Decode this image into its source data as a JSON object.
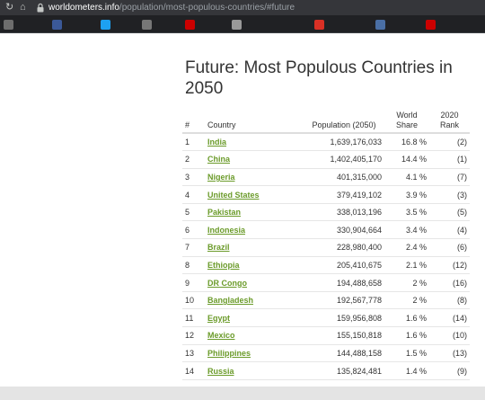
{
  "browser": {
    "url_domain": "worldometers.info",
    "url_path": "/population/most-populous-countries/#future",
    "refresh_icon": "refresh-icon",
    "home_icon": "home-icon",
    "lock_icon": "lock-icon"
  },
  "bookmarks": [
    {
      "color": "#6d6d6d"
    },
    {
      "color": "#3b5998"
    },
    {
      "color": "#1da1f2"
    },
    {
      "color": "#777777"
    },
    {
      "color": "#cc0000"
    },
    {
      "color": "#999999"
    },
    {
      "color": "#d93025"
    },
    {
      "color": "#4a6fa5"
    },
    {
      "color": "#cc0000"
    },
    {
      "color": "#d93025"
    }
  ],
  "page": {
    "title": "Future: Most Populous Countries in 2050",
    "link_color": "#6b9b2a"
  },
  "table": {
    "headers": {
      "rank": "#",
      "country": "Country",
      "population": "Population (2050)",
      "share": "World Share",
      "rank2020": "2020 Rank"
    },
    "rows": [
      {
        "n": "1",
        "country": "India",
        "population": "1,639,176,033",
        "share": "16.8 %",
        "rank2020": "(2)"
      },
      {
        "n": "2",
        "country": "China",
        "population": "1,402,405,170",
        "share": "14.4 %",
        "rank2020": "(1)"
      },
      {
        "n": "3",
        "country": "Nigeria",
        "population": "401,315,000",
        "share": "4.1 %",
        "rank2020": "(7)"
      },
      {
        "n": "4",
        "country": "United States",
        "population": "379,419,102",
        "share": "3.9 %",
        "rank2020": "(3)"
      },
      {
        "n": "5",
        "country": "Pakistan",
        "population": "338,013,196",
        "share": "3.5 %",
        "rank2020": "(5)"
      },
      {
        "n": "6",
        "country": "Indonesia",
        "population": "330,904,664",
        "share": "3.4 %",
        "rank2020": "(4)"
      },
      {
        "n": "7",
        "country": "Brazil",
        "population": "228,980,400",
        "share": "2.4 %",
        "rank2020": "(6)"
      },
      {
        "n": "8",
        "country": "Ethiopia",
        "population": "205,410,675",
        "share": "2.1 %",
        "rank2020": "(12)"
      },
      {
        "n": "9",
        "country": "DR Congo",
        "population": "194,488,658",
        "share": "2 %",
        "rank2020": "(16)"
      },
      {
        "n": "10",
        "country": "Bangladesh",
        "population": "192,567,778",
        "share": "2 %",
        "rank2020": "(8)"
      },
      {
        "n": "11",
        "country": "Egypt",
        "population": "159,956,808",
        "share": "1.6 %",
        "rank2020": "(14)"
      },
      {
        "n": "12",
        "country": "Mexico",
        "population": "155,150,818",
        "share": "1.6 %",
        "rank2020": "(10)"
      },
      {
        "n": "13",
        "country": "Philippines",
        "population": "144,488,158",
        "share": "1.5 %",
        "rank2020": "(13)"
      },
      {
        "n": "14",
        "country": "Russia",
        "population": "135,824,481",
        "share": "1.4 %",
        "rank2020": "(9)"
      }
    ]
  }
}
